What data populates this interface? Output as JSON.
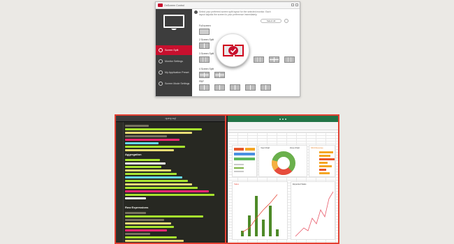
{
  "app": {
    "title": "OnScreen Control",
    "info_text": "Select your preferred screen split layout for the selected monitor. Each layout adjusts the screen to your preference immediately.",
    "select_button": "Select All",
    "sidebar": [
      {
        "label": "Screen Split",
        "active": true
      },
      {
        "label": "Monitor Settings",
        "active": false
      },
      {
        "label": "My Application Preset",
        "active": false
      },
      {
        "label": "Screen Mode Settings",
        "active": false
      }
    ],
    "sections": [
      "Full screen",
      "2 Screen Split",
      "3 Screen Split",
      "4 Screen Split",
      "PBP"
    ],
    "accent_color": "#c8102e"
  },
  "editor": {
    "title": "query.sql",
    "headings": [
      "Aggregation",
      "Row Expressions"
    ]
  },
  "excel": {
    "card_titles": [
      "Year Chart",
      "Zone Chart",
      "Sales",
      "Expected Sales",
      "SKU Revenue"
    ],
    "donut_label": "Rate",
    "accent_color": "#217346"
  }
}
